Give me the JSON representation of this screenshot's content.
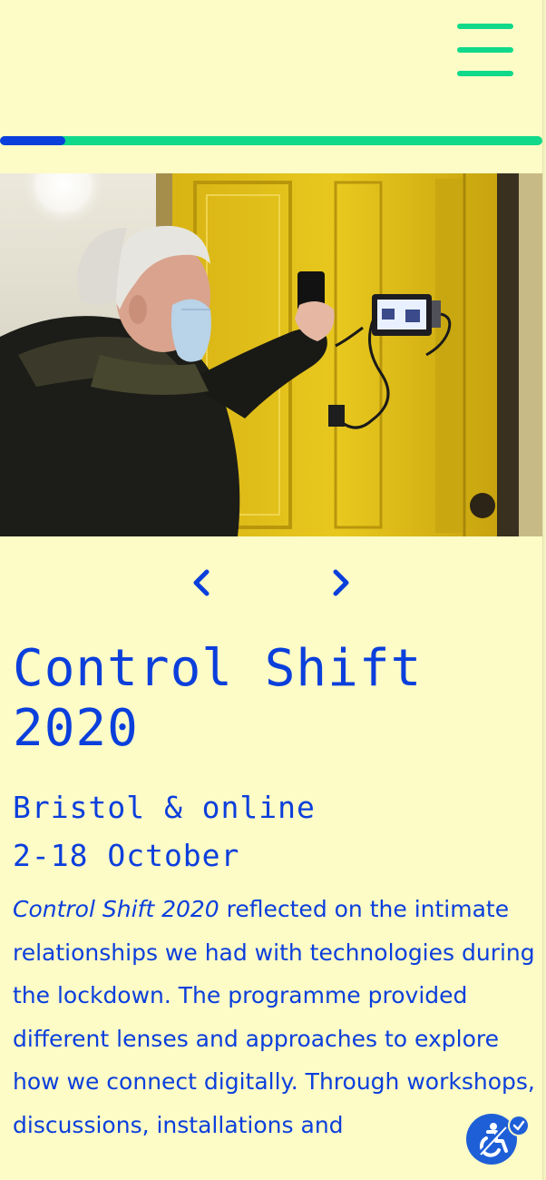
{
  "colors": {
    "background": "#fdfbc6",
    "primary_blue": "#0b3fdc",
    "accent_green": "#10d98a",
    "accessibility_blue": "#1e5fd8"
  },
  "header": {
    "menu_icon": "hamburger-menu-icon"
  },
  "progress": {
    "fraction": 0.12
  },
  "hero": {
    "image_description": "man-scanning-screen-on-yellow-door-photo"
  },
  "carousel": {
    "prev_icon": "chevron-left-icon",
    "next_icon": "chevron-right-icon"
  },
  "event": {
    "title": "Control Shift 2020",
    "location": "Bristol & online",
    "dates": "2-18 October",
    "description_italic": "Control Shift 2020",
    "description_rest": " reflected on the intimate relationships we had with technologies during the lockdown. The programme provided different lenses and approaches to explore how we connect digitally. Through workshops, discussions, installations and"
  },
  "accessibility": {
    "icon": "accessibility-icon",
    "badge_icon": "checkmark-icon"
  }
}
